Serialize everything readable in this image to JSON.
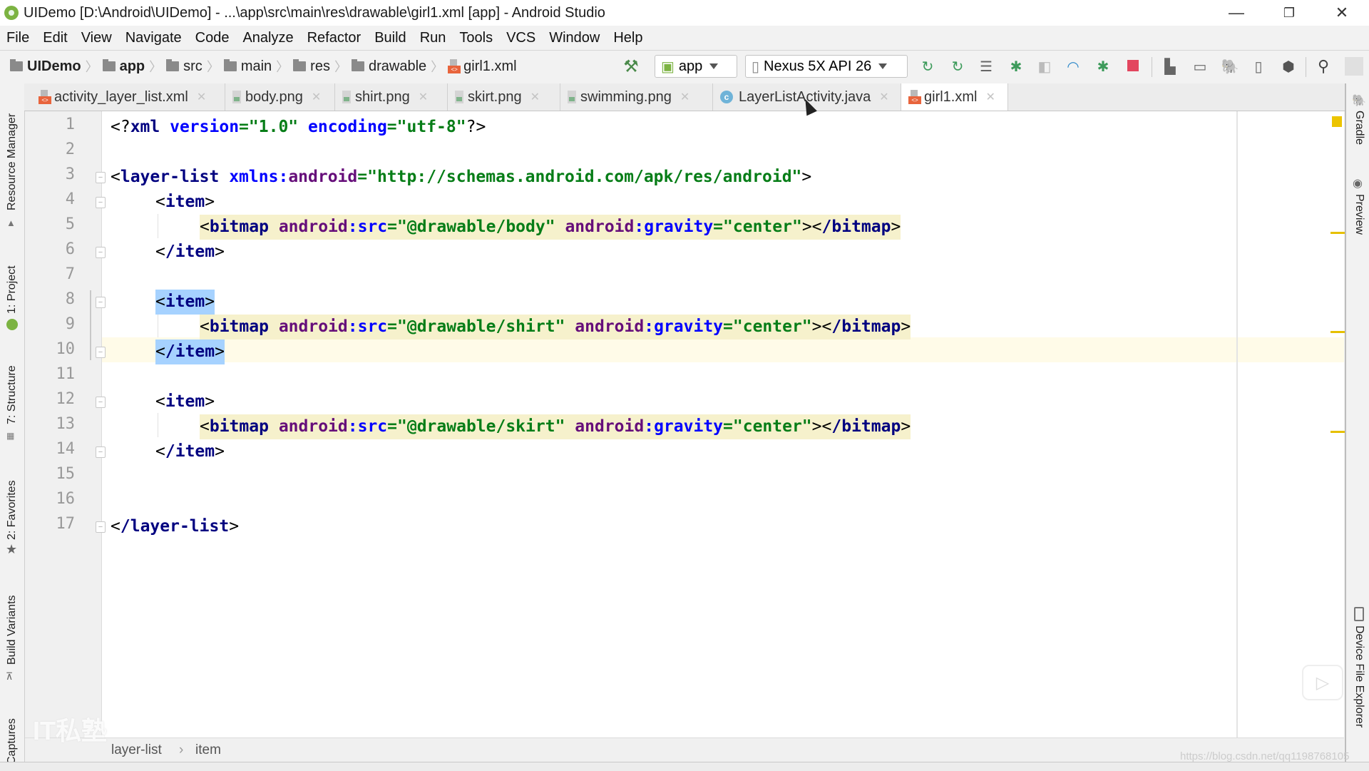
{
  "window": {
    "title": "UIDemo [D:\\Android\\UIDemo] - ...\\app\\src\\main\\res\\drawable\\girl1.xml [app] - Android Studio",
    "controls": {
      "minimize": "—",
      "restore": "❐",
      "close": "✕"
    }
  },
  "menu": [
    "File",
    "Edit",
    "View",
    "Navigate",
    "Code",
    "Analyze",
    "Refactor",
    "Build",
    "Run",
    "Tools",
    "VCS",
    "Window",
    "Help"
  ],
  "breadcrumb_nav": [
    {
      "label": "UIDemo",
      "icon": "folder-icon",
      "bold": true
    },
    {
      "label": "app",
      "icon": "folder-icon",
      "bold": true
    },
    {
      "label": "src",
      "icon": "folder-icon"
    },
    {
      "label": "main",
      "icon": "folder-icon"
    },
    {
      "label": "res",
      "icon": "res-folder-icon"
    },
    {
      "label": "drawable",
      "icon": "folder-icon"
    },
    {
      "label": "girl1.xml",
      "icon": "xml-file-icon"
    }
  ],
  "toolbar": {
    "run_config": "app",
    "device": "Nexus 5X API 26",
    "icons": [
      "hammer-icon",
      "apply-changes-icon",
      "apply-code-changes-icon",
      "sync-icon",
      "debug-icon",
      "coverage-icon",
      "profile-icon",
      "attach-debugger-icon",
      "stop-icon",
      "project-structure-icon",
      "terminal-icon",
      "gradle-sync-icon",
      "avd-manager-icon",
      "sdk-manager-icon",
      "search-icon",
      "user-icon"
    ]
  },
  "tabs": [
    {
      "label": "activity_layer_list.xml",
      "icon": "xml-file-icon",
      "active": false
    },
    {
      "label": "body.png",
      "icon": "image-file-icon",
      "active": false
    },
    {
      "label": "shirt.png",
      "icon": "image-file-icon",
      "active": false
    },
    {
      "label": "skirt.png",
      "icon": "image-file-icon",
      "active": false
    },
    {
      "label": "swimming.png",
      "icon": "image-file-icon",
      "active": false
    },
    {
      "label": "LayerListActivity.java",
      "icon": "java-class-icon",
      "active": false
    },
    {
      "label": "girl1.xml",
      "icon": "xml-file-icon",
      "active": true
    }
  ],
  "left_tools": [
    "Resource Manager",
    "1: Project",
    "7: Structure",
    "2: Favorites",
    "Build Variants",
    "Captures"
  ],
  "right_tools": [
    "Gradle",
    "Preview",
    "Device File Explorer"
  ],
  "editor": {
    "file": "girl1.xml",
    "caret_line": 10,
    "line_numbers": [
      "1",
      "2",
      "3",
      "4",
      "5",
      "6",
      "7",
      "8",
      "9",
      "10",
      "11",
      "12",
      "13",
      "14",
      "15",
      "16",
      "17"
    ],
    "lines": [
      "<?xml version=\"1.0\" encoding=\"utf-8\"?>",
      "",
      "<layer-list xmlns:android=\"http://schemas.android.com/apk/res/android\">",
      "    <item>",
      "        <bitmap android:src=\"@drawable/body\" android:gravity=\"center\"></bitmap>",
      "    </item>",
      "",
      "    <item>",
      "        <bitmap android:src=\"@drawable/shirt\" android:gravity=\"center\"></bitmap>",
      "    </item>",
      "",
      "    <item>",
      "        <bitmap android:src=\"@drawable/skirt\" android:gravity=\"center\"></bitmap>",
      "    </item>",
      "",
      "",
      "</layer-list>"
    ]
  },
  "code_tokens": {
    "xml_decl_open": "<?",
    "xml": "xml",
    "version": "version",
    "version_val": "\"1.0\"",
    "encoding": "encoding",
    "encoding_val": "\"utf-8\"",
    "xml_decl_close": "?>",
    "layer_list": "layer-list",
    "xmlns": "xmlns",
    "android": "android",
    "ns_val": "\"http://schemas.android.com/apk/res/android\"",
    "item": "item",
    "bitmap": "bitmap",
    "src": "src",
    "gravity": "gravity",
    "body_val": "\"@drawable/body\"",
    "shirt_val": "\"@drawable/shirt\"",
    "skirt_val": "\"@drawable/skirt\"",
    "center_val": "\"center\"",
    "lt": "<",
    "gt": ">",
    "slash": "/",
    "colon": ":",
    "eq": "=",
    "sp": " "
  },
  "editor_breadcrumb": [
    "layer-list",
    "item"
  ],
  "editor_breadcrumb_sep": "›",
  "watermarks": {
    "logo": "IT私塾",
    "url": "https://blog.csdn.net/qq1198768105"
  },
  "colors": {
    "tag": "#000080",
    "namespace": "#660e7a",
    "attribute": "#0000ff",
    "value": "#067d17",
    "selection": "#a6d2ff",
    "highlight": "#f6f1cc",
    "warning": "#ecc400"
  }
}
